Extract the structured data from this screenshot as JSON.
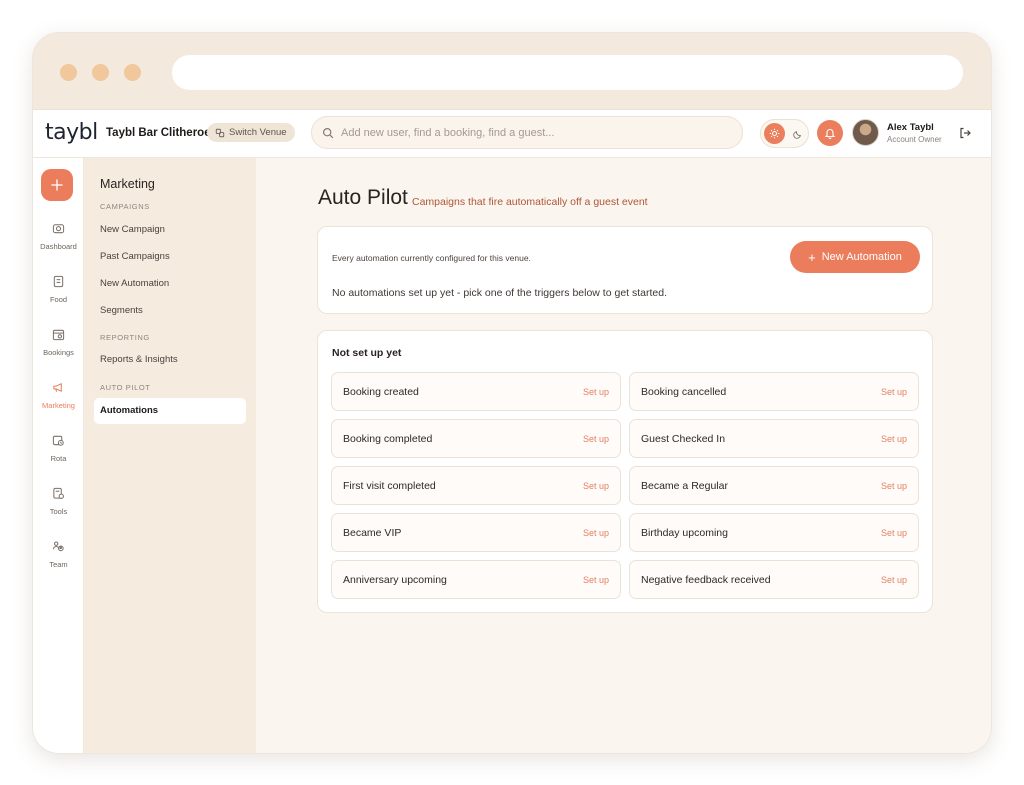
{
  "brand": {
    "logo": "taybl"
  },
  "header": {
    "venue_name": "Taybl Bar Clitheroe",
    "switch_venue_label": "Switch Venue",
    "search_placeholder": "Add new user, find a booking, find a guest...",
    "user_name": "Alex Taybl",
    "user_role": "Account Owner",
    "icons": [
      "switch-icon",
      "search-icon",
      "sun-icon",
      "moon-icon",
      "bell-icon",
      "logout-icon"
    ]
  },
  "rail": {
    "items": [
      {
        "label": "Dashboard",
        "icon": "camera-icon"
      },
      {
        "label": "Food",
        "icon": "menu-icon"
      },
      {
        "label": "Bookings",
        "icon": "calendar-icon"
      },
      {
        "label": "Marketing",
        "icon": "megaphone-icon"
      },
      {
        "label": "Rota",
        "icon": "schedule-icon"
      },
      {
        "label": "Tools",
        "icon": "tools-icon"
      },
      {
        "label": "Team",
        "icon": "team-icon"
      }
    ],
    "active": "Marketing"
  },
  "submenu": {
    "title": "Marketing",
    "sections": [
      {
        "heading": "CAMPAIGNS",
        "items": [
          "New Campaign",
          "Past Campaigns",
          "New Automation",
          "Segments"
        ]
      },
      {
        "heading": "REPORTING",
        "items": [
          "Reports & Insights"
        ]
      },
      {
        "heading": "AUTO PILOT",
        "items": [
          "Automations"
        ]
      }
    ],
    "active": "Automations"
  },
  "main": {
    "title": "Auto Pilot",
    "subtitle": "Campaigns that fire automatically off a guest event",
    "automations": {
      "description": "Every automation currently configured for this venue.",
      "new_button": "New Automation",
      "empty_text": "No automations set up yet - pick one of the triggers below to get started."
    },
    "triggers": {
      "title": "Not set up yet",
      "action_label": "Set up",
      "items": [
        "Booking created",
        "Booking cancelled",
        "Booking completed",
        "Guest Checked In",
        "First visit completed",
        "Became a Regular",
        "Became VIP",
        "Birthday upcoming",
        "Anniversary upcoming",
        "Negative feedback received"
      ]
    }
  },
  "colors": {
    "accent": "#ec7d5c",
    "sidebar": "#f5ebdf",
    "background": "#faf5ee",
    "subtitle": "#b0563a"
  }
}
